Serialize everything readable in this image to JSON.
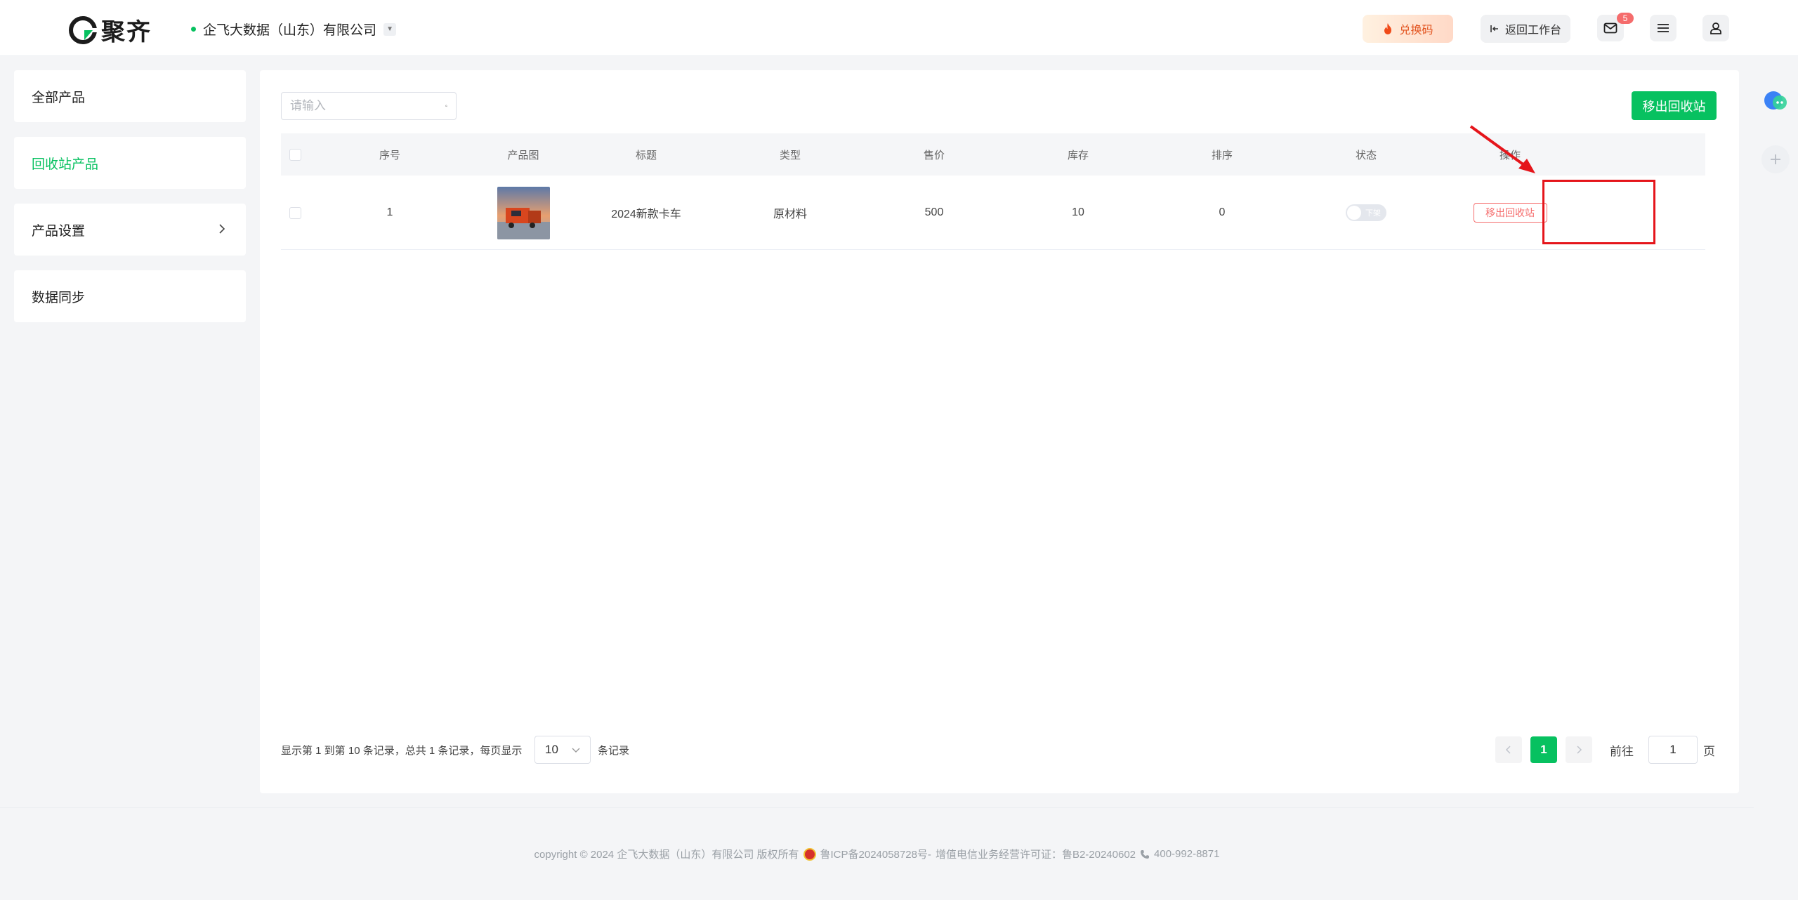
{
  "header": {
    "logo_text": "聚齐",
    "company": "企飞大数据（山东）有限公司",
    "redeem_label": "兑换码",
    "return_label": "返回工作台",
    "mail_badge": "5"
  },
  "sidebar": {
    "items": [
      {
        "label": "全部产品"
      },
      {
        "label": "回收站产品"
      },
      {
        "label": "产品设置"
      },
      {
        "label": "数据同步"
      }
    ]
  },
  "toolbar": {
    "search_placeholder": "请输入",
    "move_out_label": "移出回收站"
  },
  "table": {
    "headers": [
      "序号",
      "产品图",
      "标题",
      "类型",
      "售价",
      "库存",
      "排序",
      "状态",
      "操作"
    ],
    "rows": [
      {
        "index": "1",
        "title": "2024新款卡车",
        "type": "原材料",
        "price": "500",
        "stock": "10",
        "sort": "0",
        "status": "下架",
        "action": "移出回收站"
      }
    ]
  },
  "pagination": {
    "info": "显示第 1 到第 10 条记录，总共 1 条记录，每页显示",
    "page_size": "10",
    "records_suffix": "条记录",
    "current_page": "1",
    "goto_label": "前往",
    "goto_value": "1",
    "page_suffix": "页"
  },
  "footer": {
    "copyright": "copyright © 2024 企飞大数据（山东）有限公司 版权所有",
    "icp": "鲁ICP备2024058728号-",
    "license": "增值电信业务经营许可证：鲁B2-20240602",
    "phone": "400-992-8871"
  },
  "colors": {
    "brand": "#07c160",
    "danger": "#f56c6c",
    "annotation": "#e5151b"
  }
}
